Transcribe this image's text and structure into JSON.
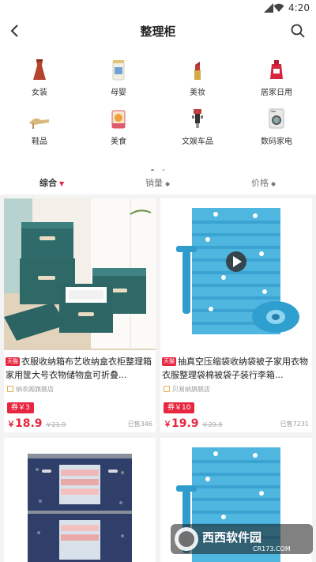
{
  "status_bar": {
    "time": "4:20"
  },
  "header": {
    "title": "整理柜"
  },
  "categories": [
    {
      "label": "女装",
      "icon": "dress-icon"
    },
    {
      "label": "母婴",
      "icon": "baby-formula-icon"
    },
    {
      "label": "美妆",
      "icon": "lipstick-icon"
    },
    {
      "label": "居家日用",
      "icon": "detergent-bottle-icon"
    },
    {
      "label": "鞋品",
      "icon": "high-heel-icon"
    },
    {
      "label": "美食",
      "icon": "snack-icon"
    },
    {
      "label": "文娱车品",
      "icon": "car-charger-icon"
    },
    {
      "label": "数码家电",
      "icon": "washing-machine-icon"
    }
  ],
  "sort_bar": {
    "items": [
      {
        "label": "综合",
        "active": true
      },
      {
        "label": "销量",
        "active": false
      },
      {
        "label": "价格",
        "active": false
      }
    ]
  },
  "products": [
    {
      "name": "衣服收纳箱布艺收纳盒衣柜整理箱家用筐大号衣物储物盒可折叠...",
      "shop": "纳衣阁旗舰店",
      "coupon": "券￥3",
      "price_symbol": "￥",
      "price": "18.9",
      "old_price": "￥21.9",
      "sold": "已售346"
    },
    {
      "name": "抽真空压缩袋收纳袋被子家用衣物衣服整理袋棉被袋子装行李箱...",
      "shop": "贝易纳旗舰店",
      "coupon": "券￥10",
      "price_symbol": "￥",
      "price": "19.9",
      "old_price": "￥29.9",
      "sold": "已售7231"
    }
  ],
  "watermark": {
    "brand": "西西软件园",
    "url": "CR173.COM"
  },
  "colors": {
    "accent": "#e8263f",
    "background": "#f3f3f3"
  }
}
